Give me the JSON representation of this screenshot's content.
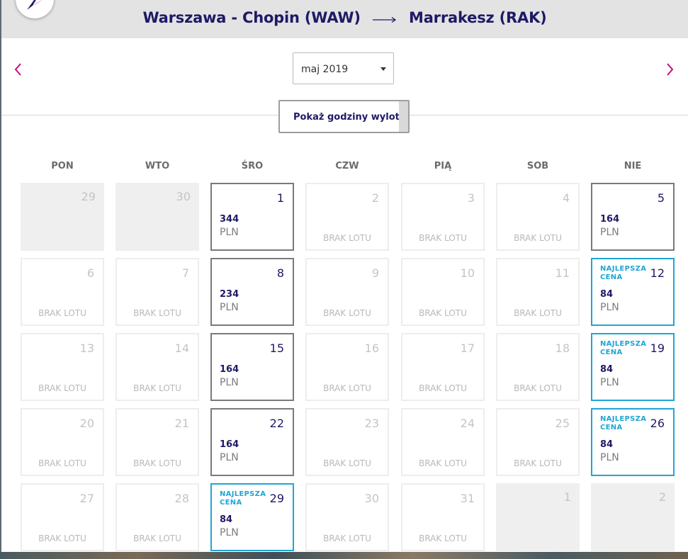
{
  "header": {
    "origin": "Warszawa - Chopin (WAW)",
    "destination": "Marrakesz (RAK)"
  },
  "month_select": {
    "value": "maj 2019"
  },
  "departure_times_toggle": {
    "label": "Pokaż godziny wylotu"
  },
  "weekdays": [
    "PON",
    "WTO",
    "ŚRO",
    "CZW",
    "PIĄ",
    "SOB",
    "NIE"
  ],
  "labels": {
    "no_flight": "BRAK LOTU",
    "best_price": "NAJLEPSZA CENA",
    "currency": "PLN"
  },
  "colors": {
    "brand_navy": "#1e1a66",
    "best_price_blue": "#20a5d6",
    "accent_magenta": "#c0117f"
  },
  "weeks": [
    [
      {
        "day": "29",
        "state": "outside"
      },
      {
        "day": "30",
        "state": "outside"
      },
      {
        "day": "1",
        "state": "flight",
        "price": "344",
        "currency": "PLN"
      },
      {
        "day": "2",
        "state": "noflight",
        "text": "BRAK LOTU"
      },
      {
        "day": "3",
        "state": "noflight",
        "text": "BRAK LOTU"
      },
      {
        "day": "4",
        "state": "noflight",
        "text": "BRAK LOTU"
      },
      {
        "day": "5",
        "state": "flight",
        "price": "164",
        "currency": "PLN"
      }
    ],
    [
      {
        "day": "6",
        "state": "noflight",
        "text": "BRAK LOTU"
      },
      {
        "day": "7",
        "state": "noflight",
        "text": "BRAK LOTU"
      },
      {
        "day": "8",
        "state": "flight",
        "price": "234",
        "currency": "PLN"
      },
      {
        "day": "9",
        "state": "noflight",
        "text": "BRAK LOTU"
      },
      {
        "day": "10",
        "state": "noflight",
        "text": "BRAK LOTU"
      },
      {
        "day": "11",
        "state": "noflight",
        "text": "BRAK LOTU"
      },
      {
        "day": "12",
        "state": "best",
        "tag": "NAJLEPSZA CENA",
        "price": "84",
        "currency": "PLN"
      }
    ],
    [
      {
        "day": "13",
        "state": "noflight",
        "text": "BRAK LOTU"
      },
      {
        "day": "14",
        "state": "noflight",
        "text": "BRAK LOTU"
      },
      {
        "day": "15",
        "state": "flight",
        "price": "164",
        "currency": "PLN"
      },
      {
        "day": "16",
        "state": "noflight",
        "text": "BRAK LOTU"
      },
      {
        "day": "17",
        "state": "noflight",
        "text": "BRAK LOTU"
      },
      {
        "day": "18",
        "state": "noflight",
        "text": "BRAK LOTU"
      },
      {
        "day": "19",
        "state": "best",
        "tag": "NAJLEPSZA CENA",
        "price": "84",
        "currency": "PLN"
      }
    ],
    [
      {
        "day": "20",
        "state": "noflight",
        "text": "BRAK LOTU"
      },
      {
        "day": "21",
        "state": "noflight",
        "text": "BRAK LOTU"
      },
      {
        "day": "22",
        "state": "flight",
        "price": "164",
        "currency": "PLN"
      },
      {
        "day": "23",
        "state": "noflight",
        "text": "BRAK LOTU"
      },
      {
        "day": "24",
        "state": "noflight",
        "text": "BRAK LOTU"
      },
      {
        "day": "25",
        "state": "noflight",
        "text": "BRAK LOTU"
      },
      {
        "day": "26",
        "state": "best",
        "tag": "NAJLEPSZA CENA",
        "price": "84",
        "currency": "PLN"
      }
    ],
    [
      {
        "day": "27",
        "state": "noflight",
        "text": "BRAK LOTU"
      },
      {
        "day": "28",
        "state": "noflight",
        "text": "BRAK LOTU"
      },
      {
        "day": "29",
        "state": "best",
        "tag": "NAJLEPSZA CENA",
        "price": "84",
        "currency": "PLN"
      },
      {
        "day": "30",
        "state": "noflight",
        "text": "BRAK LOTU"
      },
      {
        "day": "31",
        "state": "noflight",
        "text": "BRAK LOTU"
      },
      {
        "day": "1",
        "state": "outside"
      },
      {
        "day": "2",
        "state": "outside"
      }
    ]
  ]
}
